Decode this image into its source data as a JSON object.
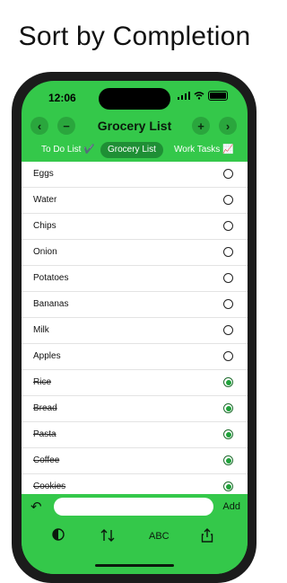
{
  "headline": "Sort by Completion",
  "status": {
    "time": "12:06"
  },
  "navbar": {
    "title": "Grocery List",
    "prev_icon": "chevron-left-icon",
    "remove_icon": "minus-icon",
    "add_icon": "plus-icon",
    "next_icon": "chevron-right-icon"
  },
  "tabs": [
    {
      "label": "To Do List ✔️",
      "active": false
    },
    {
      "label": "Grocery List",
      "active": true
    },
    {
      "label": "Work Tasks 📈",
      "active": false
    }
  ],
  "items": [
    {
      "label": "Eggs",
      "done": false
    },
    {
      "label": "Water",
      "done": false
    },
    {
      "label": "Chips",
      "done": false
    },
    {
      "label": "Onion",
      "done": false
    },
    {
      "label": "Potatoes",
      "done": false
    },
    {
      "label": "Bananas",
      "done": false
    },
    {
      "label": "Milk",
      "done": false
    },
    {
      "label": "Apples",
      "done": false
    },
    {
      "label": "Rice",
      "done": true
    },
    {
      "label": "Bread",
      "done": true
    },
    {
      "label": "Pasta",
      "done": true
    },
    {
      "label": "Coffee",
      "done": true
    },
    {
      "label": "Cookies",
      "done": true
    }
  ],
  "bottombar": {
    "add_label": "Add",
    "abc_label": "ABC",
    "input_placeholder": ""
  },
  "colors": {
    "accent": "#34c84a",
    "accent_dark": "#1f8f35",
    "radio_checked": "#1fa23a"
  }
}
